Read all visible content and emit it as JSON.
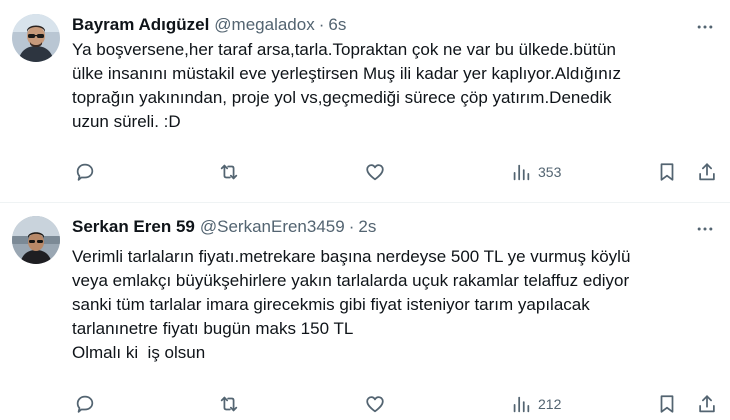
{
  "tweets": [
    {
      "author_name": "Bayram Adıgüzel",
      "handle": "@megaladox",
      "separator": "·",
      "time": "6s",
      "text_lines": [
        "Ya boşversene,her taraf arsa,tarla.Topraktan çok ne var bu ülkede.bütün",
        "ülke insanını müstakil eve yerleştirsen Muş ili kadar yer kaplıyor.Aldığınız",
        "toprağın yakınından, proje yol vs,geçmediği sürece çöp yatırım.Denedik",
        "uzun süreli. :D"
      ],
      "views": "353",
      "icons": [
        "reply-icon",
        "retweet-icon",
        "like-icon",
        "views-icon",
        "bookmark-icon",
        "share-icon",
        "more-icon"
      ]
    },
    {
      "author_name": "Serkan Eren 59",
      "handle": "@SerkanEren3459",
      "separator": "·",
      "time": "2s",
      "text_lines": [
        "Verimli tarlaların fiyatı.metrekare başına nerdeyse 500 TL ye vurmuş köylü",
        "veya emlakçı büyükşehirlere yakın tarlalarda uçuk rakamlar telaffuz ediyor",
        "sanki tüm tarlalar imara girecekmis gibi fiyat isteniyor tarım yapılacak",
        "tarlanınetre fiyatı bugün maks 150 TL",
        "Olmalı ki  iş olsun"
      ],
      "views": "212",
      "icons": [
        "reply-icon",
        "retweet-icon",
        "like-icon",
        "views-icon",
        "bookmark-icon",
        "share-icon",
        "more-icon"
      ]
    }
  ],
  "colors": {
    "text": "#0f1419",
    "secondary": "#536471",
    "divider": "#eff3f4",
    "background": "#ffffff"
  }
}
